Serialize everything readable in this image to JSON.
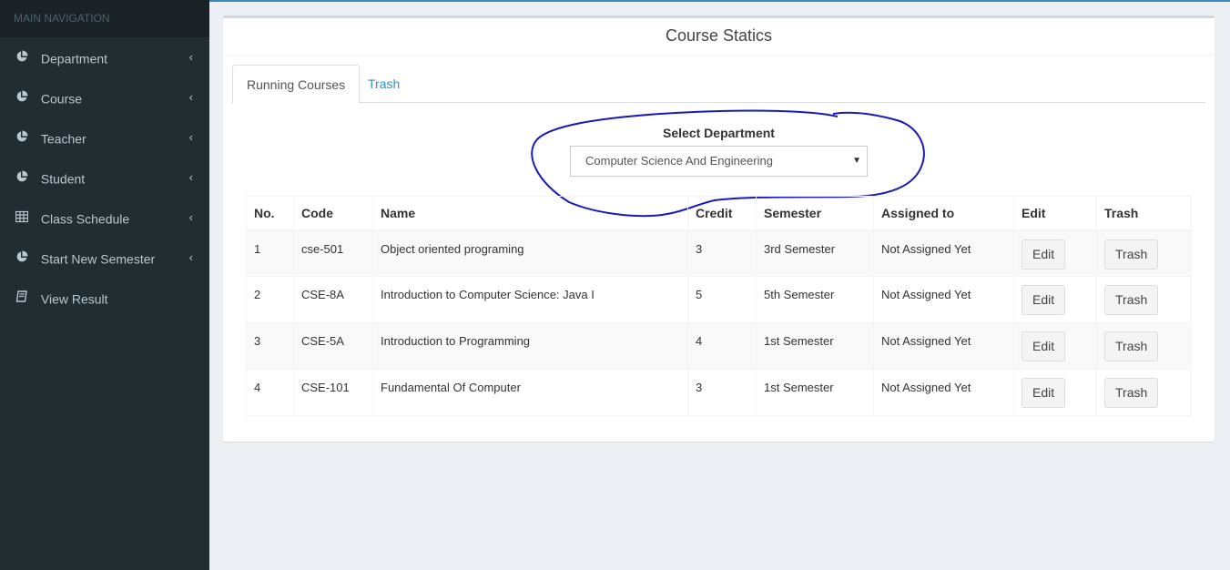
{
  "sidebar": {
    "header": "MAIN NAVIGATION",
    "items": [
      {
        "label": "Department",
        "icon": "pie-chart-icon"
      },
      {
        "label": "Course",
        "icon": "pie-chart-icon"
      },
      {
        "label": "Teacher",
        "icon": "pie-chart-icon"
      },
      {
        "label": "Student",
        "icon": "pie-chart-icon"
      },
      {
        "label": "Class Schedule",
        "icon": "table-icon"
      },
      {
        "label": "Start New Semester",
        "icon": "pie-chart-icon"
      },
      {
        "label": "View Result",
        "icon": "book-icon"
      }
    ]
  },
  "main": {
    "title": "Course Statics",
    "tabs": [
      {
        "label": "Running Courses",
        "active": true
      },
      {
        "label": "Trash",
        "active": false
      }
    ],
    "select": {
      "label": "Select Department",
      "value": "Computer Science And Engineering"
    },
    "table": {
      "headers": [
        "No.",
        "Code",
        "Name",
        "Credit",
        "Semester",
        "Assigned to",
        "Edit",
        "Trash"
      ],
      "rows": [
        {
          "no": "1",
          "code": "cse-501",
          "name": "Object oriented programing",
          "credit": "3",
          "semester": "3rd Semester",
          "assigned": "Not Assigned Yet",
          "edit": "Edit",
          "trash": "Trash"
        },
        {
          "no": "2",
          "code": "CSE-8A",
          "name": "Introduction to Computer Science: Java I",
          "credit": "5",
          "semester": "5th Semester",
          "assigned": "Not Assigned Yet",
          "edit": "Edit",
          "trash": "Trash"
        },
        {
          "no": "3",
          "code": "CSE-5A",
          "name": "Introduction to Programming",
          "credit": "4",
          "semester": "1st Semester",
          "assigned": "Not Assigned Yet",
          "edit": "Edit",
          "trash": "Trash"
        },
        {
          "no": "4",
          "code": "CSE-101",
          "name": "Fundamental Of Computer",
          "credit": "3",
          "semester": "1st Semester",
          "assigned": "Not Assigned Yet",
          "edit": "Edit",
          "trash": "Trash"
        }
      ]
    }
  },
  "colors": {
    "sidebar_bg": "#222d32",
    "accent": "#3c8dbc",
    "annotation_ink": "#1a1ab8"
  }
}
